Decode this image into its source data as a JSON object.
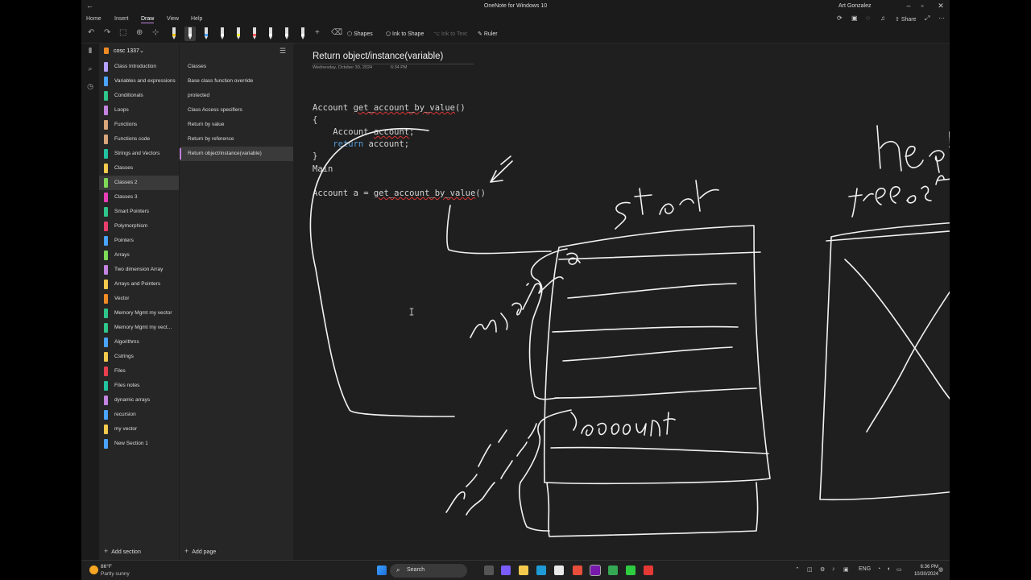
{
  "window": {
    "title": "OneNote for Windows 10",
    "user": "Art Gonzalez"
  },
  "menu": {
    "tabs": [
      "Home",
      "Insert",
      "Draw",
      "View",
      "Help"
    ],
    "active": "Draw",
    "share_label": "Share"
  },
  "toolbar": {
    "shapes_label": "Shapes",
    "ink_to_shape_label": "Ink to Shape",
    "ink_to_text_label": "Ink to Text",
    "ruler_label": "Ruler",
    "pen_colors": [
      "#f5c400",
      "#ffffff",
      "#4aa3ff",
      "#ffffff",
      "#f2ef3a",
      "#ff5a5a",
      "#ffffff",
      "#ffffff",
      "#ffffff"
    ]
  },
  "notebook": {
    "name": "cosc 1337"
  },
  "sections": [
    {
      "label": "Class Introduction",
      "color": "#b4a0ff"
    },
    {
      "label": "Variables and expressions",
      "color": "#4aa3ff"
    },
    {
      "label": "Conditionals",
      "color": "#2ec48a"
    },
    {
      "label": "Loops",
      "color": "#c383e0"
    },
    {
      "label": "Functions",
      "color": "#d8a67a"
    },
    {
      "label": "Functions code",
      "color": "#d8a67a"
    },
    {
      "label": "Strings and Vectors",
      "color": "#22c2a0"
    },
    {
      "label": "Classes",
      "color": "#f2c94c"
    },
    {
      "label": "Classes 2",
      "color": "#7ed957"
    },
    {
      "label": "Classes 3",
      "color": "#e83fb8"
    },
    {
      "label": "Smart Pointers",
      "color": "#2ec48a"
    },
    {
      "label": "Polymorphism",
      "color": "#e83f6f"
    },
    {
      "label": "Pointers",
      "color": "#4aa3ff"
    },
    {
      "label": "Arrays",
      "color": "#7ed957"
    },
    {
      "label": "Two dimension Array",
      "color": "#c383e0"
    },
    {
      "label": "Arrays and Pointers",
      "color": "#f2c94c"
    },
    {
      "label": "Vector",
      "color": "#f08a24"
    },
    {
      "label": "Memory Mgmt my vector",
      "color": "#2ec48a"
    },
    {
      "label": "Memory Mgmt my vect...",
      "color": "#2ec48a"
    },
    {
      "label": "Algorithms",
      "color": "#4aa3ff"
    },
    {
      "label": "Cstrings",
      "color": "#f2c94c"
    },
    {
      "label": "Files",
      "color": "#e83f4f"
    },
    {
      "label": "Files notes",
      "color": "#22c2a0"
    },
    {
      "label": "dynamic arrays",
      "color": "#c383e0"
    },
    {
      "label": "recursion",
      "color": "#4aa3ff"
    },
    {
      "label": "my vector",
      "color": "#f2c94c"
    },
    {
      "label": "New Section 1",
      "color": "#4aa3ff"
    }
  ],
  "active_section": "Classes 2",
  "pages": [
    {
      "label": "Classes"
    },
    {
      "label": "Base class function override"
    },
    {
      "label": "protected"
    },
    {
      "label": "Class Access specifiers"
    },
    {
      "label": "Return by value"
    },
    {
      "label": "Return by reference"
    },
    {
      "label": "Return object/instance(variable)"
    }
  ],
  "active_page": "Return object/instance(variable)",
  "footer": {
    "add_section": "Add section",
    "add_page": "Add page"
  },
  "page": {
    "title": "Return object/instance(variable)",
    "date": "Wednesday, October 30, 2024",
    "time": "6:34 PM",
    "code": {
      "line1_type": "Account ",
      "line1_func": "get_account_by_value",
      "line1_parens": "()",
      "brace_open": "{",
      "line2_type": "    Account ",
      "line2_var": "account",
      "line2_end": ";",
      "line3_indent": "    ",
      "line3_kw": "return",
      "line3_rest": " account;",
      "brace_close": "}",
      "main_label": "Main",
      "line_call_prefix": "Account a = ",
      "line_call_func": "get_account_by_value",
      "line_call_end": "()"
    }
  },
  "taskbar": {
    "weather_temp": "86°F",
    "weather_condition": "Partly sunny",
    "search_label": "Search",
    "lang": "ENG",
    "time": "6:36 PM",
    "date": "10/30/2024"
  }
}
